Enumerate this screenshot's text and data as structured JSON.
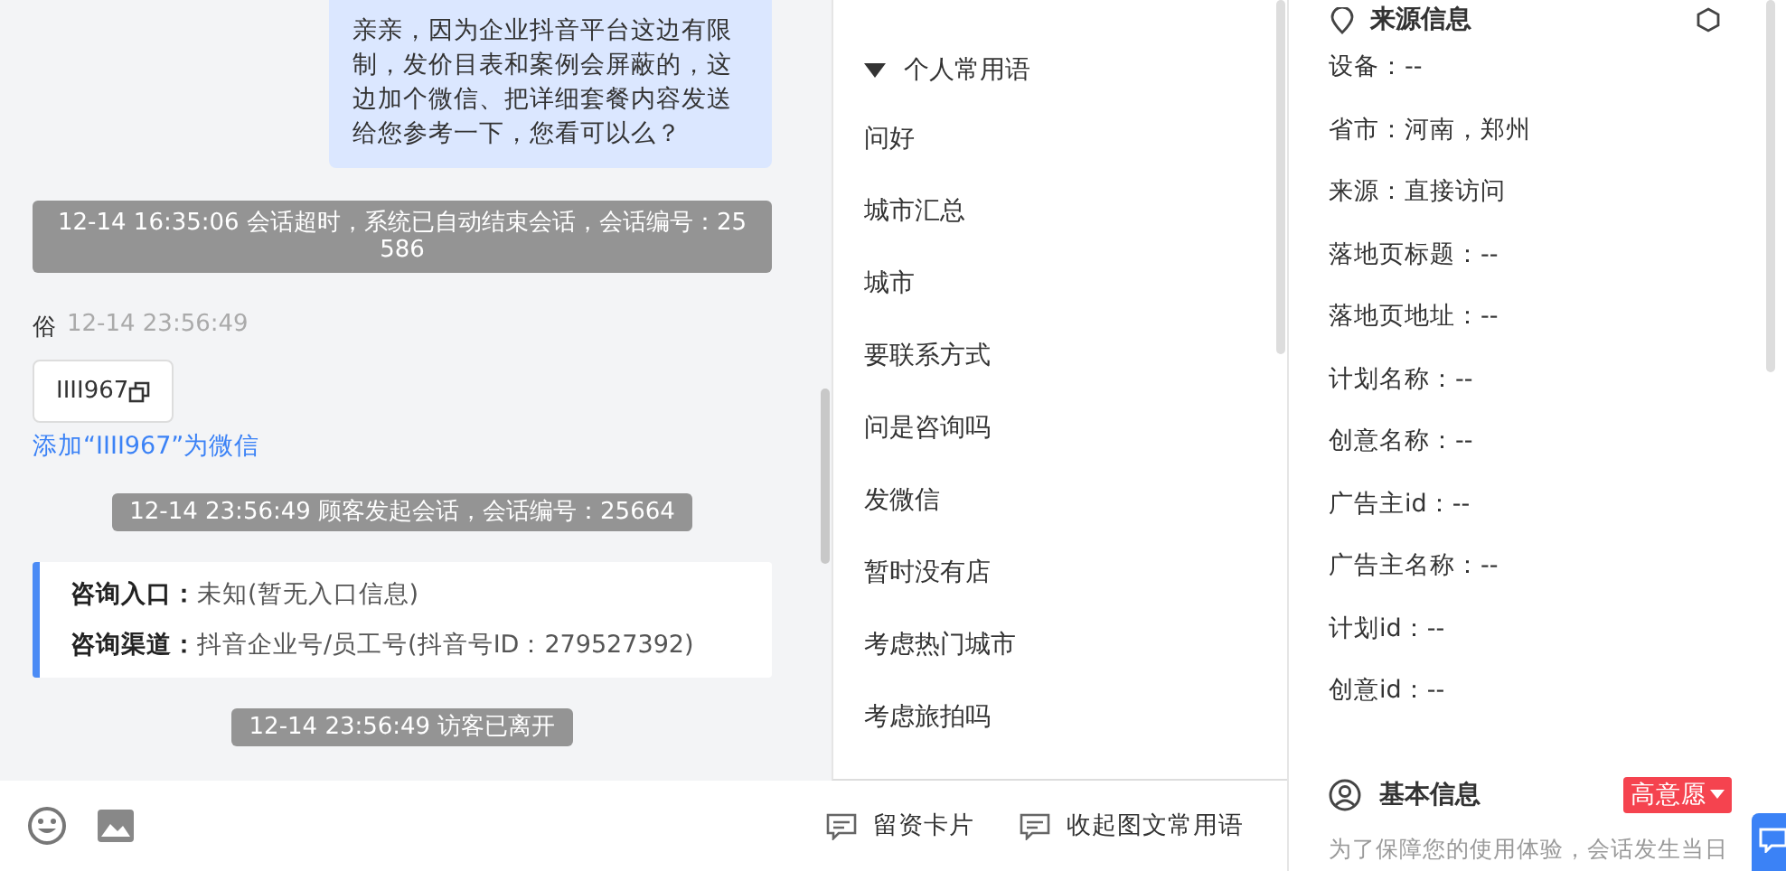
{
  "chat": {
    "messages": [
      {
        "kind": "bubble",
        "text": "亲亲，因为企业抖音平台这边有限制，发价目表和案例会屏蔽的，这边加个微信、把详细套餐内容发送给您参考一下，您看可以么？"
      },
      {
        "kind": "system",
        "text": "12-14 16:35:06 会话超时，系统已自动结束会话，会话编号：25586"
      },
      {
        "kind": "sender",
        "name": "俗",
        "time": "12-14 23:56:49"
      },
      {
        "kind": "contact",
        "text": "IIII967"
      },
      {
        "kind": "link",
        "text": "添加“IIII967”为微信"
      },
      {
        "kind": "system",
        "text": "12-14 23:56:49 顾客发起会话，会话编号：25664"
      },
      {
        "kind": "info",
        "rows": [
          "**咨询入口：**未知(暂无入口信息)",
          "**咨询渠道：**抖音企业号/员工号(抖音号ID：279527392)"
        ]
      },
      {
        "kind": "system",
        "text": "12-14 23:56:49 访客已离开"
      }
    ]
  },
  "toolbar": {
    "buttons": [
      "留资卡片",
      "收起图文常用语"
    ]
  },
  "quick_replies": {
    "title": "个人常用语",
    "expanded": true,
    "items": [
      "问好",
      "城市汇总",
      "城市",
      "要联系方式",
      "问是咨询吗",
      "发微信",
      "暂时没有店",
      "考虑热门城市",
      "考虑旅拍吗"
    ]
  },
  "source_info": {
    "title": "来源信息",
    "rows": [
      "设备：--",
      "省市：河南，郑州",
      "来源：直接访问",
      "落地页标题：--",
      "落地页地址：--",
      "计划名称：--",
      "创意名称：--",
      "广告主id：--",
      "广告主名称：--",
      "计划id：--",
      "创意id：--"
    ]
  },
  "basic_info": {
    "title": "基本信息",
    "tag": "高意愿",
    "note": "为了保障您的使用体验，会话发生当日"
  }
}
